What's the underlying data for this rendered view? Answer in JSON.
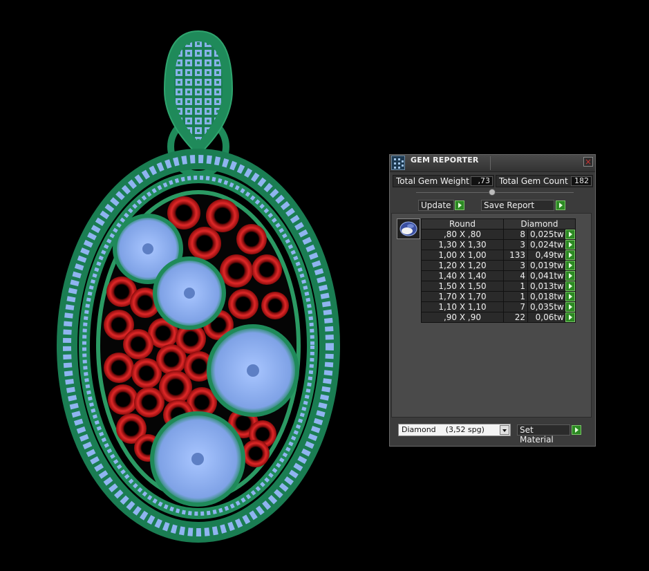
{
  "panel": {
    "title": "GEM REPORTER",
    "close_label": "×",
    "total_gem_weight_label": "Total Gem Weight",
    "total_gem_weight_value": ",73",
    "total_gem_count_label": "Total Gem Count",
    "total_gem_count_value": "182",
    "update_label": "Update",
    "save_report_label": "Save Report",
    "table": {
      "col_shape": "Round",
      "col_material": "Diamond",
      "rows": [
        {
          "size": ",80 X ,80",
          "count": "8",
          "weight": "0,025tw"
        },
        {
          "size": "1,30 X 1,30",
          "count": "3",
          "weight": "0,024tw"
        },
        {
          "size": "1,00 X 1,00",
          "count": "133",
          "weight": "0,49tw"
        },
        {
          "size": "1,20 X 1,20",
          "count": "3",
          "weight": "0,019tw"
        },
        {
          "size": "1,40 X 1,40",
          "count": "4",
          "weight": "0,041tw"
        },
        {
          "size": "1,50 X 1,50",
          "count": "1",
          "weight": "0,013tw"
        },
        {
          "size": "1,70 X 1,70",
          "count": "1",
          "weight": "0,018tw"
        },
        {
          "size": "1,10 X 1,10",
          "count": "7",
          "weight": "0,035tw"
        },
        {
          "size": ",90 X ,90",
          "count": "22",
          "weight": "0,06tw"
        }
      ]
    },
    "material_dropdown_value": "Diamond    (3,52 spg)",
    "set_material_label": "Set Material"
  },
  "colors": {
    "metal": "#1f8a5a",
    "gem_blue": "#8fb4f0",
    "gem_red": "#d42020",
    "button_green": "#2c8a23"
  },
  "icons": [
    "gem-reporter-icon",
    "close-icon",
    "gem-thumbnail-icon",
    "arrow-right-icon",
    "chevron-down-icon"
  ]
}
